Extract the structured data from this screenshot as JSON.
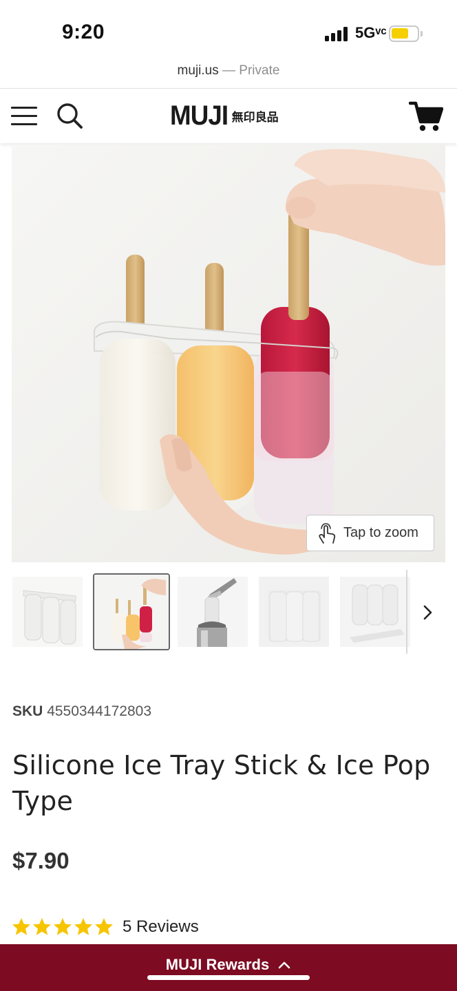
{
  "status_bar": {
    "time": "9:20",
    "network": "5Gᵛᶜ",
    "battery_color": "#f5cf00"
  },
  "browser": {
    "domain": "muji.us",
    "mode": "— Private"
  },
  "header": {
    "menu_icon": "hamburger-icon",
    "search_icon": "search-icon",
    "logo_latin": "MUJI",
    "logo_kanji": "無印良品",
    "cart_icon": "cart-icon"
  },
  "hero": {
    "zoom_label": "Tap to zoom",
    "zoom_icon": "tap-hand-icon"
  },
  "thumbnails": {
    "count_visible": 5,
    "selected_index": 1,
    "next_icon": "chevron-right-icon"
  },
  "product": {
    "sku_label": "SKU",
    "sku_value": "4550344172803",
    "title": "Silicone Ice Tray Stick & Ice Pop Type",
    "price": "$7.90",
    "rating_stars": 5,
    "reviews": "5 Reviews",
    "star_color": "#f6c500"
  },
  "rewards": {
    "label": "MUJI Rewards",
    "chevron_icon": "chevron-up-icon",
    "background_color": "#7d0b22"
  }
}
